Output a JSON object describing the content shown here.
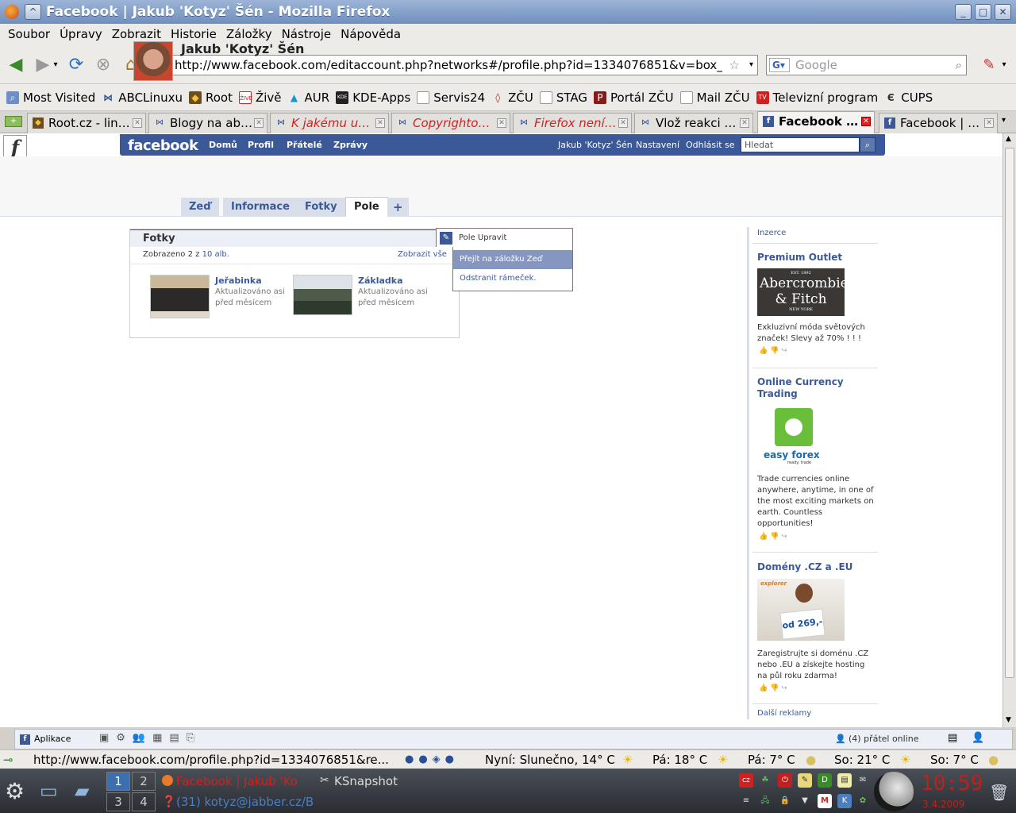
{
  "window": {
    "title": "Facebook | Jakub 'Kotyz' Šén - Mozilla Firefox"
  },
  "menubar": [
    "Soubor",
    "Úpravy",
    "Zobrazit",
    "Historie",
    "Záložky",
    "Nástroje",
    "Nápověda"
  ],
  "navbar": {
    "url": "http://www.facebook.com/editaccount.php?networks#/profile.php?id=1334076851&v=box_3",
    "search_placeholder": "Google"
  },
  "bookmarks": [
    {
      "label": "Most Visited",
      "icon": "most-visited-icon"
    },
    {
      "label": "ABCLinuxu",
      "icon": "abclinuxu-icon"
    },
    {
      "label": "Root",
      "icon": "root-icon"
    },
    {
      "label": "Živě",
      "icon": "zive-icon"
    },
    {
      "label": "AUR",
      "icon": "arch-icon"
    },
    {
      "label": "KDE-Apps",
      "icon": "kde-apps-icon"
    },
    {
      "label": "Servis24",
      "icon": "page-icon"
    },
    {
      "label": "ZČU",
      "icon": "zcu-icon"
    },
    {
      "label": "STAG",
      "icon": "page-icon"
    },
    {
      "label": "Portál ZČU",
      "icon": "portal-icon"
    },
    {
      "label": "Mail ZČU",
      "icon": "page-icon"
    },
    {
      "label": "Televizní program",
      "icon": "tv-icon"
    },
    {
      "label": "CUPS",
      "icon": "cups-icon"
    }
  ],
  "tabs": [
    {
      "label": "Root.cz - lin…",
      "active": false
    },
    {
      "label": "Blogy na ab…",
      "active": false
    },
    {
      "label": "K jakému u…",
      "active": false
    },
    {
      "label": "Copyrighto…",
      "active": false
    },
    {
      "label": "Firefox není…",
      "active": false
    },
    {
      "label": "Vlož reakci …",
      "active": false
    },
    {
      "label": "Facebook …",
      "active": true
    },
    {
      "label": "Facebook | …",
      "active": false
    }
  ],
  "fb": {
    "logo": "facebook",
    "nav": [
      "Domů",
      "Profil",
      "Přátelé",
      "Zprávy"
    ],
    "user_nav": [
      "Jakub 'Kotyz' Šén",
      "Nastavení",
      "Odhlásit se"
    ],
    "search_placeholder": "Hledat",
    "profile_name": "Jakub 'Kotyz' Šén",
    "profile_tabs": [
      "Zeď",
      "Informace",
      "Fotky",
      "Pole",
      "+"
    ],
    "photos_box": {
      "title": "Fotky",
      "shown_prefix": "Zobrazeno 2 z",
      "shown_link": "10 alb.",
      "see_all": "Zobrazit vše",
      "albums": [
        {
          "title": "Jeřabinka",
          "desc1": "Aktualizováno asi",
          "desc2": "před měsícem"
        },
        {
          "title": "Základka",
          "desc1": "Aktualizováno asi",
          "desc2": "před měsícem"
        }
      ]
    },
    "box_menu": {
      "header": "Pole Upravit",
      "items": [
        "Přejít na záložku Zeď",
        "Odstranit rámeček."
      ]
    },
    "ads": {
      "header": "Inzerce",
      "items": [
        {
          "title": "Premium Outlet",
          "image_text": "Abercrombie & Fitch",
          "image_top": "EST. 1892",
          "image_bottom": "NEW YORK",
          "text": "Exkluzivní móda světových značek! Slevy až 70% ! ! !"
        },
        {
          "title": "Online Currency Trading",
          "image_text": "easy forex",
          "image_sub": "ready. trade",
          "text": "Trade currencies online anywhere, anytime, in one of the most exciting markets on earth. Countless opportunities!"
        },
        {
          "title": "Domény .CZ a .EU",
          "image_text": "od 269,-",
          "image_brand": "explorer",
          "text": "Zaregistrujte si doménu .CZ nebo .EU a získejte hosting na půl roku zdarma!"
        }
      ],
      "more": "Další reklamy"
    },
    "bottombar": {
      "apps": "Aplikace",
      "online": "(4) přátel online"
    }
  },
  "statusbar": {
    "url": "http://www.facebook.com/profile.php?id=1334076851&re...",
    "weather": [
      "Nyní: Slunečno, 14° C",
      "Pá: 18° C",
      "Pá: 7° C",
      "So: 21° C",
      "So: 7° C"
    ]
  },
  "panel": {
    "pager": [
      "1",
      "2",
      "3",
      "4"
    ],
    "tasks": [
      "Facebook | Jakub 'Ko",
      "KSnapshot",
      "(31) kotyz@jabber.cz/B"
    ],
    "clock": "10:59",
    "date": "3.4.2009"
  },
  "colors": {
    "fb_blue": "#3b5998",
    "clock_red": "#c0201a"
  }
}
